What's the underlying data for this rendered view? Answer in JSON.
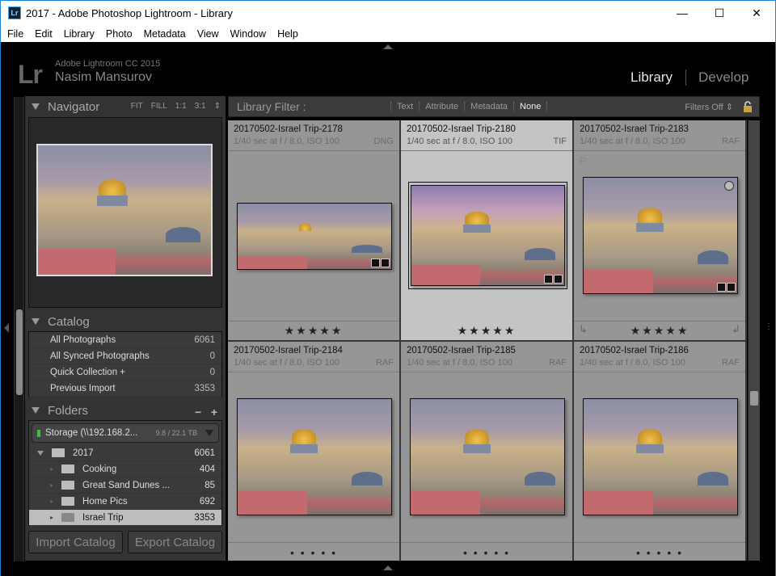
{
  "window": {
    "title": "2017 - Adobe Photoshop Lightroom - Library",
    "app_icon": "Lr",
    "controls": {
      "minimize": "—",
      "maximize": "☐",
      "close": "✕"
    }
  },
  "menu": [
    "File",
    "Edit",
    "Library",
    "Photo",
    "Metadata",
    "View",
    "Window",
    "Help"
  ],
  "identity": {
    "logo": "Lr",
    "product": "Adobe Lightroom CC 2015",
    "user": "Nasim Mansurov"
  },
  "modules": {
    "active": "Library",
    "other": "Develop"
  },
  "navigator": {
    "title": "Navigator",
    "options": [
      "FIT",
      "FILL",
      "1:1",
      "3:1"
    ],
    "options_arrow": "⇕"
  },
  "catalog": {
    "title": "Catalog",
    "items": [
      {
        "label": "All Photographs",
        "count": "6061"
      },
      {
        "label": "All Synced Photographs",
        "count": "0"
      },
      {
        "label": "Quick Collection  +",
        "count": "0"
      },
      {
        "label": "Previous Import",
        "count": "3353"
      }
    ]
  },
  "folders": {
    "title": "Folders",
    "minus": "−",
    "plus": "+",
    "volume": {
      "name": "Storage (\\\\192.168.2...",
      "size": "9.8 / 22.1 TB",
      "status_color": "#3fbf3f"
    },
    "root": {
      "name": "2017",
      "count": "6061"
    },
    "items": [
      {
        "name": "Cooking",
        "count": "404",
        "selected": false
      },
      {
        "name": "Great Sand Dunes ...",
        "count": "85",
        "selected": false
      },
      {
        "name": "Home Pics",
        "count": "692",
        "selected": false
      },
      {
        "name": "Israel Trip",
        "count": "3353",
        "selected": true
      }
    ]
  },
  "buttons": {
    "import": "Import Catalog",
    "export": "Export Catalog"
  },
  "filter": {
    "title": "Library Filter :",
    "options": [
      "Text",
      "Attribute",
      "Metadata",
      "None"
    ],
    "active": "None",
    "right": "Filters Off ⇕"
  },
  "grid": [
    {
      "filename": "20170502-Israel Trip-2178",
      "exposure": "1/40 sec at f / 8.0, ISO 100",
      "type": "DNG",
      "rating": "★★★★★"
    },
    {
      "filename": "20170502-Israel Trip-2180",
      "exposure": "1/40 sec at f / 8.0, ISO 100",
      "type": "TIF",
      "rating": "★★★★★"
    },
    {
      "filename": "20170502-Israel Trip-2183",
      "exposure": "1/40 sec at f / 8.0, ISO 100",
      "type": "RAF",
      "rating": "★★★★★"
    },
    {
      "filename": "20170502-Israel Trip-2184",
      "exposure": "1/40 sec at f / 8.0, ISO 100",
      "type": "RAF",
      "rating": "• • • • •"
    },
    {
      "filename": "20170502-Israel Trip-2185",
      "exposure": "1/40 sec at f / 8.0, ISO 100",
      "type": "RAF",
      "rating": "• • • • •"
    },
    {
      "filename": "20170502-Israel Trip-2186",
      "exposure": "1/40 sec at f / 8.0, ISO 100",
      "type": "RAF",
      "rating": "• • • • •"
    }
  ],
  "icons": {
    "rotate_left": "↳",
    "rotate_right": "↲",
    "flag": "⚐"
  }
}
